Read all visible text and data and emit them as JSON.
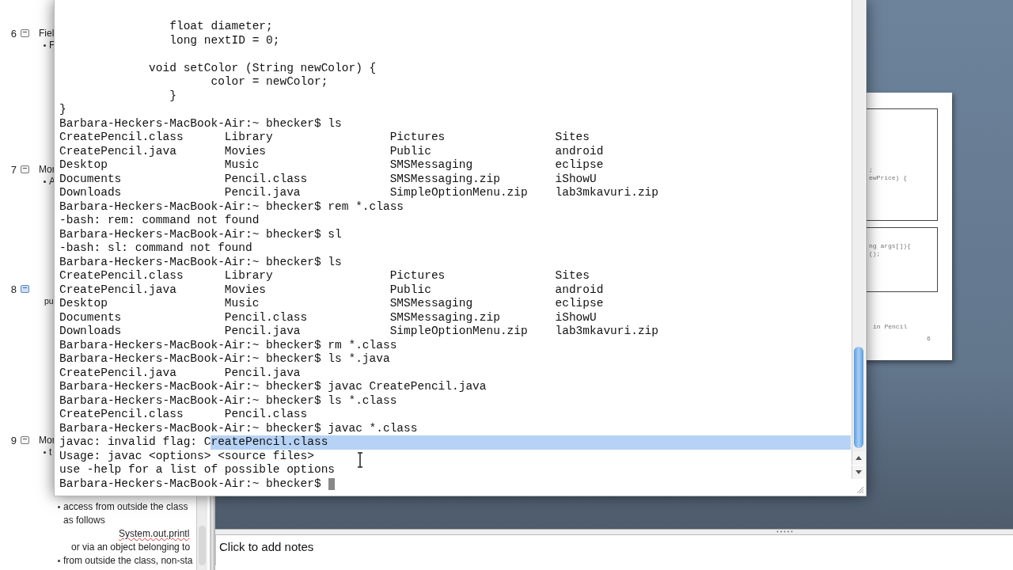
{
  "outline": {
    "slides": [
      {
        "number": "6",
        "title": "Fiel",
        "selected": false,
        "bullets": [
          {
            "kind": "bullet",
            "text": "F"
          }
        ]
      },
      {
        "number": "7",
        "title": "Mor",
        "selected": false,
        "bullets": [
          {
            "kind": "bullet",
            "text": "A"
          }
        ]
      },
      {
        "number": "8",
        "selected": true,
        "bullets": [
          {
            "kind": "plain",
            "text": "pu"
          }
        ]
      },
      {
        "number": "9",
        "title": "Mor",
        "selected": false,
        "bullets": [
          {
            "kind": "bullet",
            "text": "t"
          }
        ],
        "continuation": [
          {
            "kind": "bullet",
            "text": "access from outside the class as follows"
          },
          {
            "kind": "code",
            "text": "System.out.printl"
          },
          {
            "kind": "plain",
            "text": "or via an object belonging to"
          },
          {
            "kind": "bullet",
            "text": "from outside the class, non-sta"
          }
        ]
      }
    ]
  },
  "slide_preview": {
    "box_1_lines": [
      ";",
      "ewPrice) {"
    ],
    "box_2_lines": [
      "ng args[]){",
      "();"
    ],
    "caption": "in Pencil",
    "page_number": "6"
  },
  "notes": {
    "placeholder": "Click to add notes"
  },
  "terminal": {
    "cursor": true,
    "lines": [
      {
        "kind": "text",
        "selected": false,
        "text": "                float diameter;"
      },
      {
        "kind": "text",
        "selected": false,
        "text": "                long nextID = 0;"
      },
      {
        "kind": "blank",
        "selected": false
      },
      {
        "kind": "text",
        "selected": false,
        "text": "             void setColor (String newColor) {"
      },
      {
        "kind": "text",
        "selected": false,
        "text": "                      color = newColor;"
      },
      {
        "kind": "text",
        "selected": false,
        "text": "                }"
      },
      {
        "kind": "text",
        "selected": false,
        "text": "}"
      },
      {
        "kind": "text",
        "selected": false,
        "text": "Barbara-Heckers-MacBook-Air:~ bhecker$ ls"
      },
      {
        "kind": "text",
        "selected": false,
        "text": "CreatePencil.class      Library                 Pictures                Sites"
      },
      {
        "kind": "text",
        "selected": false,
        "text": "CreatePencil.java       Movies                  Public                  android"
      },
      {
        "kind": "text",
        "selected": false,
        "text": "Desktop                 Music                   SMSMessaging            eclipse"
      },
      {
        "kind": "text",
        "selected": false,
        "text": "Documents               Pencil.class            SMSMessaging.zip        iShowU"
      },
      {
        "kind": "text",
        "selected": false,
        "text": "Downloads               Pencil.java             SimpleOptionMenu.zip    lab3mkavuri.zip"
      },
      {
        "kind": "text",
        "selected": false,
        "text": "Barbara-Heckers-MacBook-Air:~ bhecker$ rem *.class"
      },
      {
        "kind": "text",
        "selected": false,
        "text": "-bash: rem: command not found"
      },
      {
        "kind": "text",
        "selected": false,
        "text": "Barbara-Heckers-MacBook-Air:~ bhecker$ sl"
      },
      {
        "kind": "text",
        "selected": false,
        "text": "-bash: sl: command not found"
      },
      {
        "kind": "text",
        "selected": false,
        "text": "Barbara-Heckers-MacBook-Air:~ bhecker$ ls"
      },
      {
        "kind": "text",
        "selected": false,
        "text": "CreatePencil.class      Library                 Pictures                Sites"
      },
      {
        "kind": "text",
        "selected": false,
        "text": "CreatePencil.java       Movies                  Public                  android"
      },
      {
        "kind": "text",
        "selected": false,
        "text": "Desktop                 Music                   SMSMessaging            eclipse"
      },
      {
        "kind": "text",
        "selected": false,
        "text": "Documents               Pencil.class            SMSMessaging.zip        iShowU"
      },
      {
        "kind": "text",
        "selected": false,
        "text": "Downloads               Pencil.java             SimpleOptionMenu.zip    lab3mkavuri.zip"
      },
      {
        "kind": "text",
        "selected": false,
        "text": "Barbara-Heckers-MacBook-Air:~ bhecker$ rm *.class"
      },
      {
        "kind": "text",
        "selected": false,
        "text": "Barbara-Heckers-MacBook-Air:~ bhecker$ ls *.java"
      },
      {
        "kind": "text",
        "selected": false,
        "text": "CreatePencil.java       Pencil.java"
      },
      {
        "kind": "text",
        "selected": false,
        "text": "Barbara-Heckers-MacBook-Air:~ bhecker$ javac CreatePencil.java"
      },
      {
        "kind": "text",
        "selected": false,
        "text": "Barbara-Heckers-MacBook-Air:~ bhecker$ ls *.class"
      },
      {
        "kind": "text",
        "selected": false,
        "text": "CreatePencil.class      Pencil.class"
      },
      {
        "kind": "text",
        "selected": false,
        "text": "Barbara-Heckers-MacBook-Air:~ bhecker$ javac *.class"
      },
      {
        "kind": "text",
        "selected": true,
        "text": "javac: invalid flag: C",
        "selected_text": "reatePencil.class"
      },
      {
        "kind": "text",
        "selected": false,
        "text": "Usage: javac <options> <source files>"
      },
      {
        "kind": "text",
        "selected": false,
        "text": "use -help for a list of possible options"
      },
      {
        "kind": "text",
        "selected": false,
        "text": "Barbara-Heckers-MacBook-Air:~ bhecker$"
      }
    ]
  }
}
